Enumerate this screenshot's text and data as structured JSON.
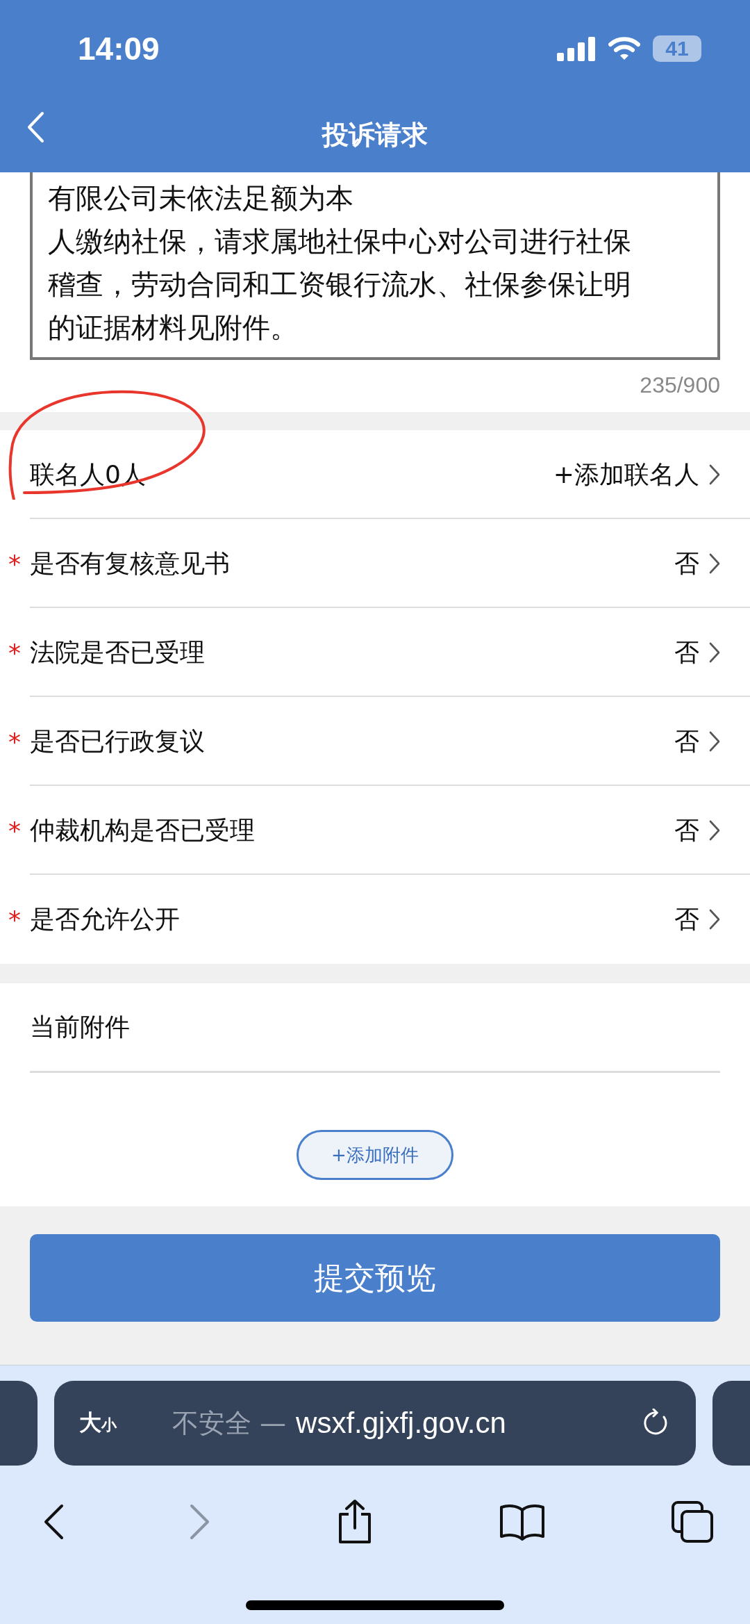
{
  "status_bar": {
    "time": "14:09",
    "battery": "41"
  },
  "header": {
    "title": "投诉请求"
  },
  "complaint_text": {
    "lines": [
      "有限公司未依法足额为本",
      "人缴纳社保，请求属地社保中心对公司进行社保",
      "稽查，劳动合同和工资银行流水、社保参保让明",
      "的证据材料见附件。"
    ],
    "counter": "235/900"
  },
  "form_rows": [
    {
      "label": "联名人0人",
      "required": false,
      "value": "+添加联名人"
    },
    {
      "label": "是否有复核意见书",
      "required": true,
      "value": "否"
    },
    {
      "label": "法院是否已受理",
      "required": true,
      "value": "否"
    },
    {
      "label": "是否已行政复议",
      "required": true,
      "value": "否"
    },
    {
      "label": "仲裁机构是否已受理",
      "required": true,
      "value": "否"
    },
    {
      "label": "是否允许公开",
      "required": true,
      "value": "否"
    }
  ],
  "required_mark": "*",
  "attachments": {
    "title": "当前附件",
    "add_button": "+添加附件"
  },
  "submit_button": "提交预览",
  "browser": {
    "text_size": "大",
    "text_size_small": "小",
    "security": "不安全 —",
    "url": "wsxf.gjxfj.gov.cn",
    "forward_disabled": true
  }
}
